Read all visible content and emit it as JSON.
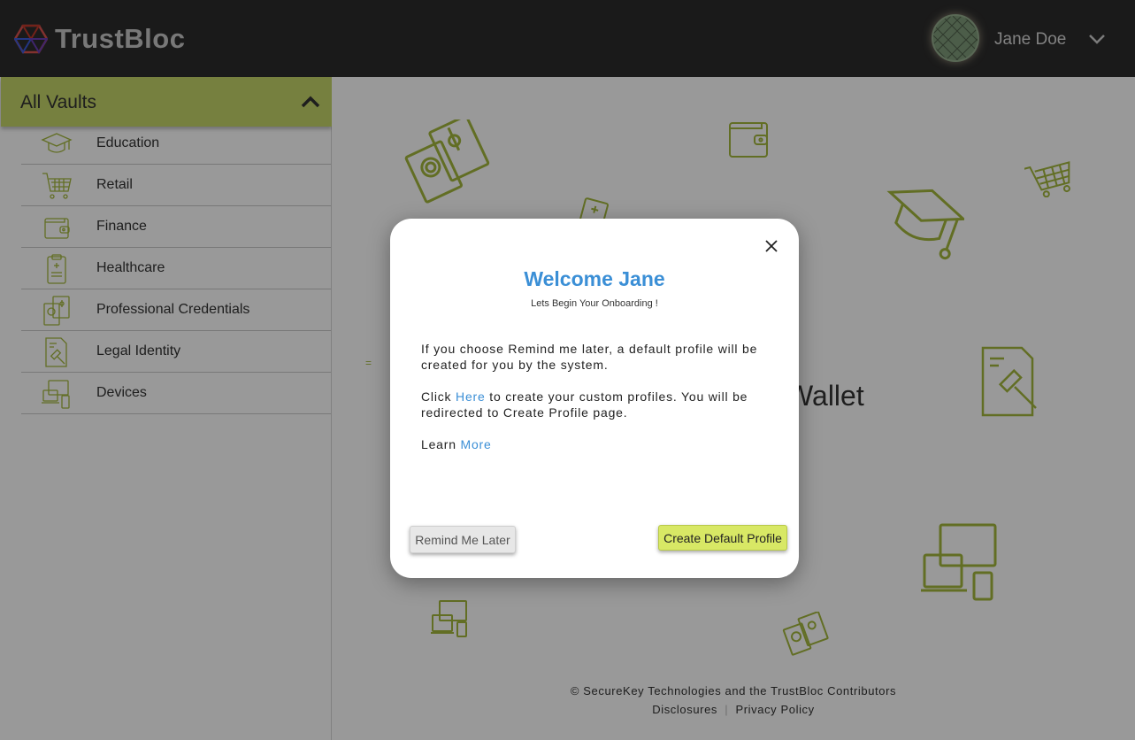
{
  "header": {
    "app_name": "TrustBloc",
    "user_name": "Jane Doe",
    "logo_icon": "cube-icon",
    "menu_icon": "chevron-down-icon"
  },
  "sidebar": {
    "title": "All Vaults",
    "items": [
      {
        "label": "Education",
        "icon": "graduation-cap-icon"
      },
      {
        "label": "Retail",
        "icon": "shopping-cart-icon"
      },
      {
        "label": "Finance",
        "icon": "wallet-icon"
      },
      {
        "label": "Healthcare",
        "icon": "clipboard-icon"
      },
      {
        "label": "Professional Credentials",
        "icon": "passport-icon"
      },
      {
        "label": "Legal Identity",
        "icon": "gavel-document-icon"
      },
      {
        "label": "Devices",
        "icon": "devices-icon"
      }
    ]
  },
  "main": {
    "heading_partial": "l Wallet",
    "footer": {
      "copyright": "© SecureKey Technologies and the TrustBloc Contributors",
      "disclosures": "Disclosures",
      "separator": "|",
      "privacy": "Privacy Policy"
    }
  },
  "modal": {
    "title": "Welcome Jane",
    "subtitle": "Lets Begin Your Onboarding !",
    "paragraph1": "If you choose Remind me later, a default profile will be created for you by the system.",
    "paragraph2_prefix": "Click ",
    "paragraph2_link": "Here",
    "paragraph2_suffix": " to create your custom profiles. You will be redirected to Create Profile page.",
    "paragraph3_prefix": "Learn ",
    "paragraph3_link": "More",
    "remind_button": "Remind Me Later",
    "create_button": "Create Default Profile",
    "close_icon": "close-icon"
  },
  "colors": {
    "accent_green": "#c5d56a",
    "button_green": "#d8e865",
    "link_blue": "#3b8fd6",
    "header_bg": "#2c2c2c",
    "icon_olive": "#a3b83c"
  }
}
